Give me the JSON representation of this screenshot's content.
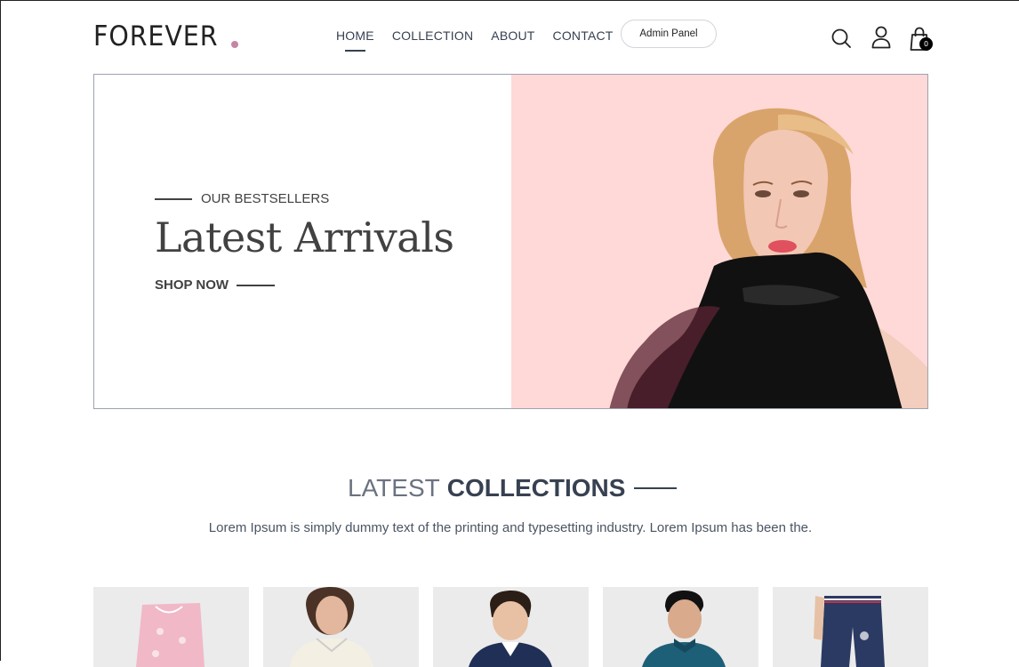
{
  "brand": {
    "name": "FOREVER",
    "dot_color": "#c586a5"
  },
  "nav": {
    "items": [
      {
        "label": "HOME",
        "active": true
      },
      {
        "label": "COLLECTION",
        "active": false
      },
      {
        "label": "ABOUT",
        "active": false
      },
      {
        "label": "CONTACT",
        "active": false
      }
    ],
    "admin_label": "Admin Panel"
  },
  "header_icons": {
    "search": "search-icon",
    "profile": "user-icon",
    "cart": "shopping-bag-icon",
    "cart_count": "0"
  },
  "hero": {
    "eyebrow": "OUR BESTSELLERS",
    "title": "Latest Arrivals",
    "cta": "SHOP NOW",
    "image_bg": "#ffd9d7"
  },
  "collections": {
    "title_light": "LATEST",
    "title_bold": "COLLECTIONS",
    "description": "Lorem Ipsum is simply dummy text of the printing and typesetting industry. Lorem Ipsum has been the."
  },
  "products": [
    {
      "name": "product-pink-pants"
    },
    {
      "name": "product-cream-shirt"
    },
    {
      "name": "product-navy-jacket-kid"
    },
    {
      "name": "product-teal-jacket"
    },
    {
      "name": "product-navy-trackpants"
    }
  ]
}
